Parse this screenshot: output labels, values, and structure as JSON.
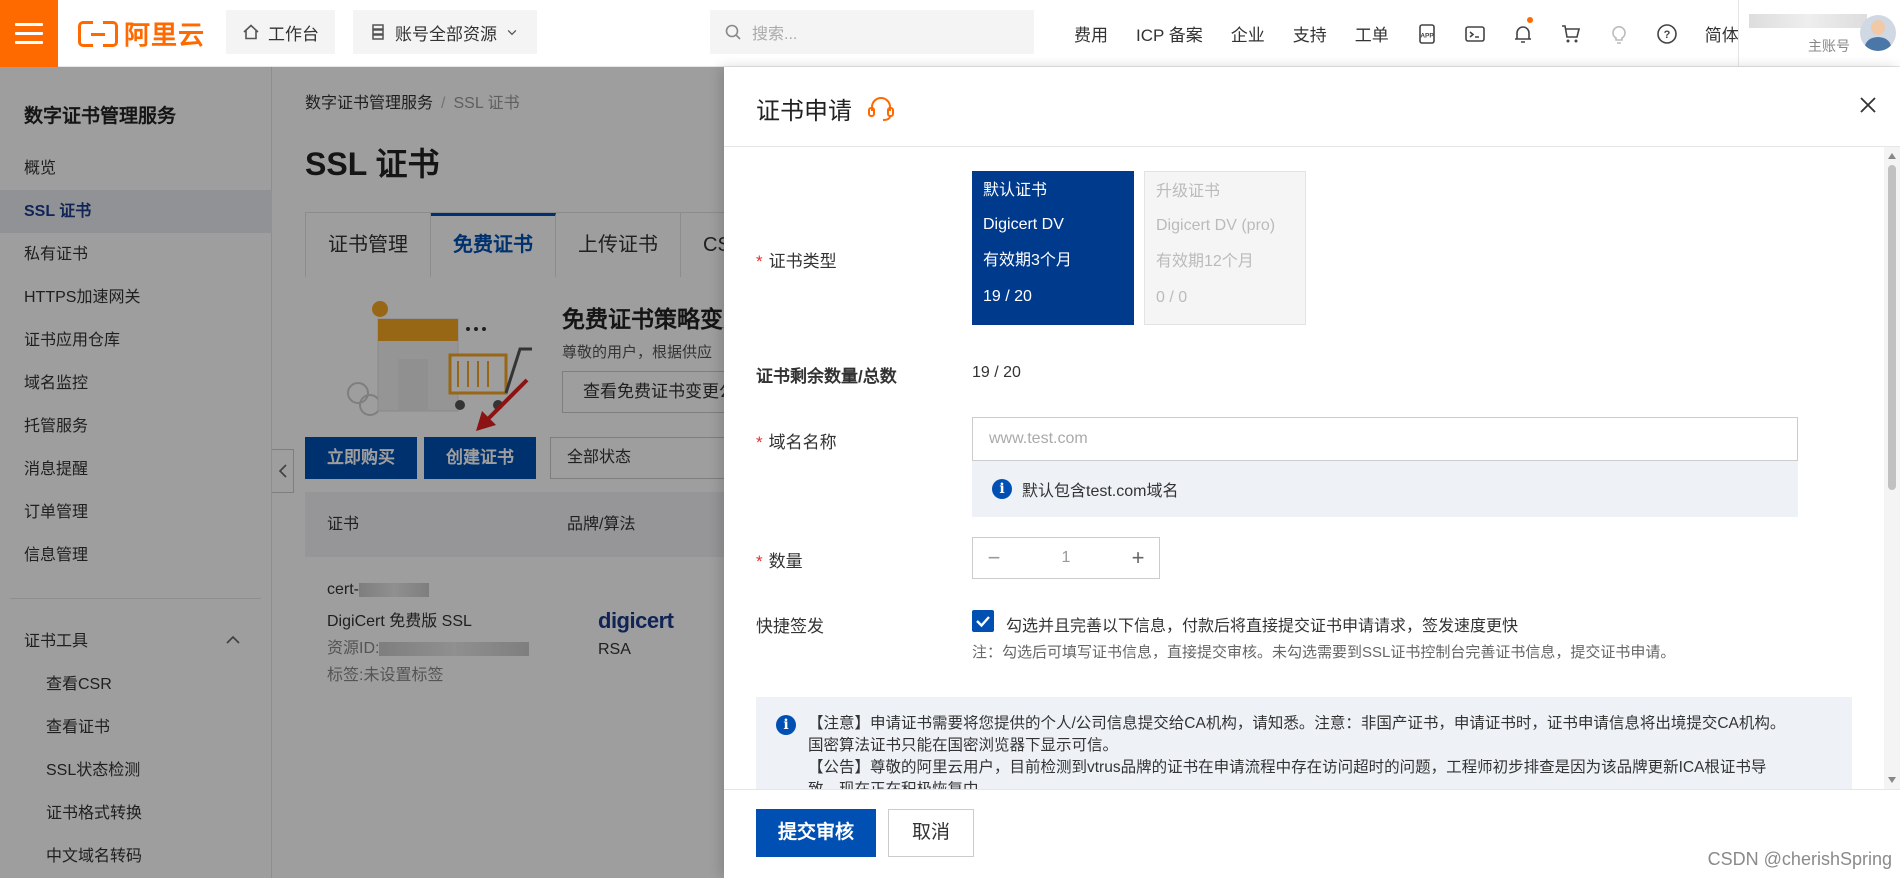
{
  "topbar": {
    "logo_text": "阿里云",
    "workbench": "工作台",
    "resources": "账号全部资源",
    "search_placeholder": "搜索...",
    "nav": [
      "费用",
      "ICP 备案",
      "企业",
      "支持",
      "工单"
    ],
    "lang": "简体",
    "account_role": "主账号",
    "brand_color": "#ff6a00"
  },
  "sidebar": {
    "title": "数字证书管理服务",
    "items": [
      "概览",
      "SSL 证书",
      "私有证书",
      "HTTPS加速网关",
      "证书应用仓库",
      "域名监控",
      "托管服务",
      "消息提醒",
      "订单管理",
      "信息管理"
    ],
    "active_index": 1,
    "group": "证书工具",
    "tools": [
      "查看CSR",
      "查看证书",
      "SSL状态检测",
      "证书格式转换",
      "中文域名转码"
    ]
  },
  "main": {
    "breadcrumb": [
      "数字证书管理服务",
      "SSL 证书"
    ],
    "title": "SSL 证书",
    "tabs": [
      "证书管理",
      "免费证书",
      "上传证书",
      "CSR管"
    ],
    "active_tab": 1,
    "promo": {
      "title": "免费证书策略变更",
      "desc": "尊敬的用户，根据供应",
      "button": "查看免费证书变更公"
    },
    "buy_button": "立即购买",
    "create_button": "创建证书",
    "status_filter": "全部状态",
    "table": {
      "headers": [
        "证书",
        "品牌/算法"
      ],
      "row": {
        "cert_prefix": "cert-",
        "cert_desc": "DigiCert 免费版 SSL",
        "resource_prefix": "资源ID:",
        "tags": "标签:未设置标签",
        "brand": "digicert",
        "algo": "RSA"
      }
    }
  },
  "drawer": {
    "title": "证书申请",
    "fields": {
      "type_label": "证书类型",
      "remaining_label": "证书剩余数量/总数",
      "remaining_value": "19 / 20",
      "domain_label": "域名名称",
      "domain_placeholder": "www.test.com",
      "domain_hint": "默认包含test.com域名",
      "qty_label": "数量",
      "qty_value": "1",
      "fast_label": "快捷签发",
      "fast_check_label": "勾选并且完善以下信息，付款后将直接提交证书申请请求，签发速度更快",
      "fast_note": "注：勾选后可填写证书信息，直接提交审核。未勾选需要到SSL证书控制台完善证书信息，提交证书申请。"
    },
    "cards": [
      {
        "name": "默认证书",
        "brand": "Digicert DV",
        "validity": "有效期3个月",
        "quota": "19 / 20"
      },
      {
        "name": "升级证书",
        "brand": "Digicert DV (pro)",
        "validity": "有效期12个月",
        "quota": "0 / 0"
      }
    ],
    "notice": [
      "【注意】申请证书需要将您提供的个人/公司信息提交给CA机构，请知悉。注意：非国产证书，申请证书时，证书申请信息将出境提交CA机构。",
      "国密算法证书只能在国密浏览器下显示可信。",
      "【公告】尊敬的阿里云用户，目前检测到vtrus品牌的证书在申请流程中存在访问超时的问题，工程师初步排查是因为该品牌更新ICA根证书导",
      "致，现在正在积极恢复中。"
    ],
    "submit": "提交审核",
    "cancel": "取消"
  },
  "watermark": "CSDN @cherishSpring"
}
